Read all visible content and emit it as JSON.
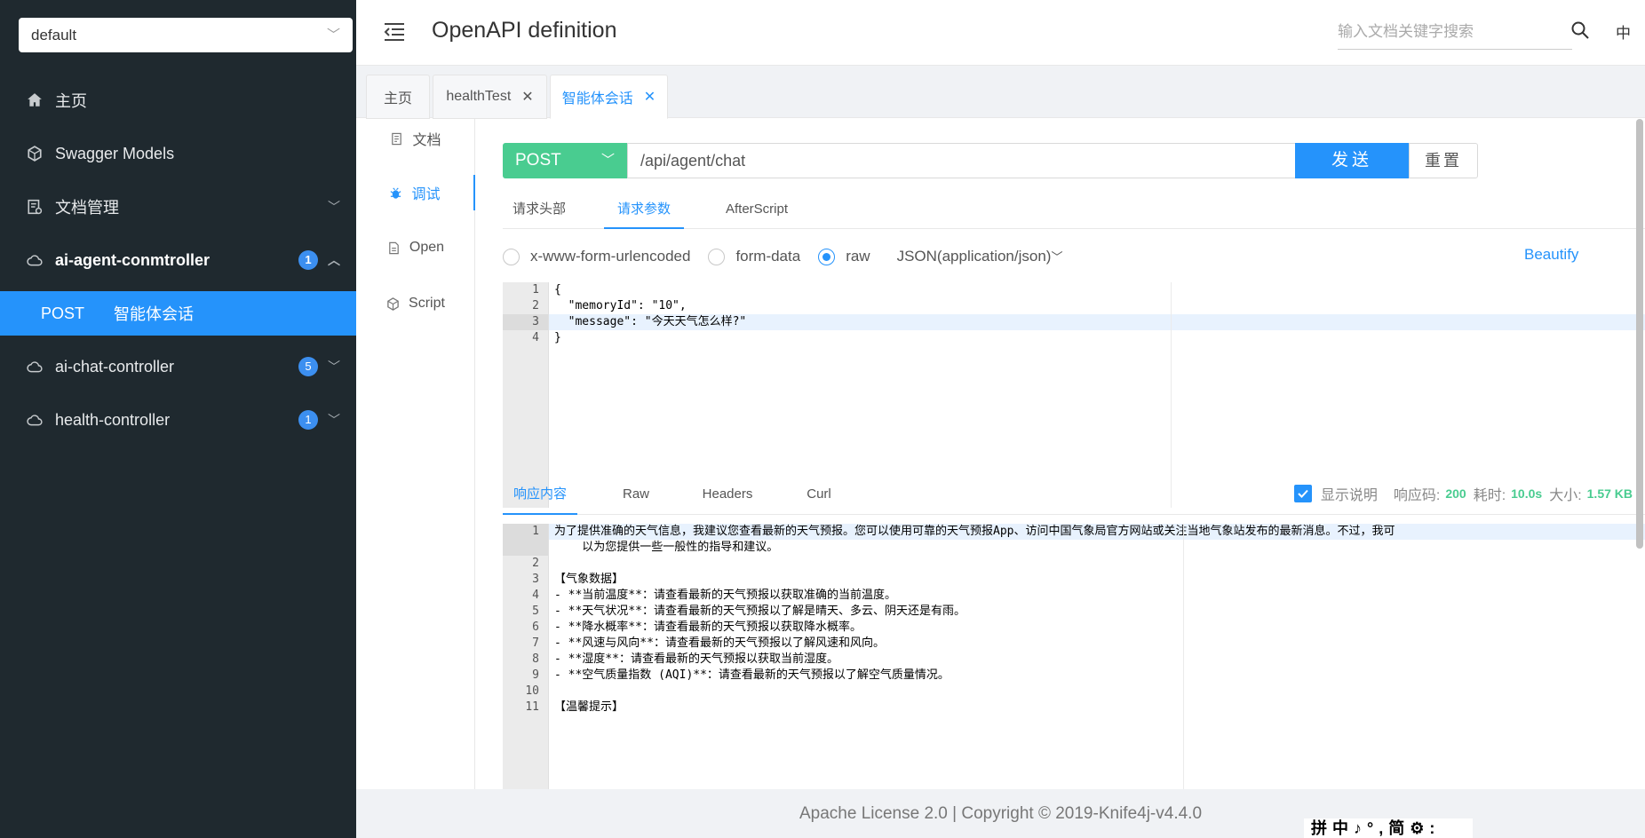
{
  "sidebar": {
    "group_select": "default",
    "menu": [
      {
        "label": "主页",
        "icon": "home-icon"
      },
      {
        "label": "Swagger Models",
        "icon": "models-icon"
      },
      {
        "label": "文档管理",
        "icon": "doc-manage-icon"
      },
      {
        "label": "ai-agent-conmtroller",
        "icon": "cloud-icon",
        "badge": "1"
      },
      {
        "label": "ai-chat-controller",
        "icon": "cloud-icon",
        "badge": "5"
      },
      {
        "label": "health-controller",
        "icon": "cloud-icon",
        "badge": "1"
      }
    ],
    "active_sub": {
      "method": "POST",
      "label": "智能体会话"
    }
  },
  "topbar": {
    "title": "OpenAPI definition",
    "search_placeholder": "输入文档关键字搜索",
    "lang": "中"
  },
  "tabs": [
    {
      "label": "主页"
    },
    {
      "label": "healthTest"
    },
    {
      "label": "智能体会话"
    }
  ],
  "leftnav": [
    "文档",
    "调试",
    "Open",
    "Script"
  ],
  "request": {
    "method": "POST",
    "url": "/api/agent/chat",
    "send_label": "发送",
    "reset_label": "重置",
    "sub_tabs": [
      "请求头部",
      "请求参数",
      "AfterScript"
    ],
    "body_types": [
      "x-www-form-urlencoded",
      "form-data",
      "raw"
    ],
    "content_type": "JSON(application/json)",
    "beautify_label": "Beautify",
    "body_lines": [
      "{",
      "  \"memoryId\": \"10\",",
      "  \"message\": \"今天天气怎么样?\"",
      "}"
    ],
    "line_numbers": [
      "1",
      "2",
      "3",
      "4"
    ]
  },
  "response": {
    "tabs": [
      "响应内容",
      "Raw",
      "Headers",
      "Curl"
    ],
    "show_desc_label": "显示说明",
    "status_label": "响应码:",
    "status": "200",
    "time_label": "耗时:",
    "time": "10.0s",
    "size_label": "大小:",
    "size": "1.57 KB",
    "line_numbers": [
      "1",
      "",
      "2",
      "3",
      "4",
      "5",
      "6",
      "7",
      "8",
      "9",
      "10",
      "11"
    ],
    "lines": [
      "为了提供准确的天气信息，我建议您查看最新的天气预报。您可以使用可靠的天气预报App、访问中国气象局官方网站或关注当地气象站发布的最新消息。不过，我可",
      "    以为您提供一些一般性的指导和建议。",
      "",
      "【气象数据】",
      "- **当前温度**：请查看最新的天气预报以获取准确的当前温度。",
      "- **天气状况**：请查看最新的天气预报以了解是晴天、多云、阴天还是有雨。",
      "- **降水概率**：请查看最新的天气预报以获取降水概率。",
      "- **风速与风向**：请查看最新的天气预报以了解风速和风向。",
      "- **湿度**：请查看最新的天气预报以获取当前湿度。",
      "- **空气质量指数 (AQI)**：请查看最新的天气预报以了解空气质量情况。",
      "",
      "【温馨提示】"
    ]
  },
  "footer": "Apache License 2.0 | Copyright © 2019-Knife4j-v4.4.0",
  "ime": "拼中♪°,简⚙:"
}
